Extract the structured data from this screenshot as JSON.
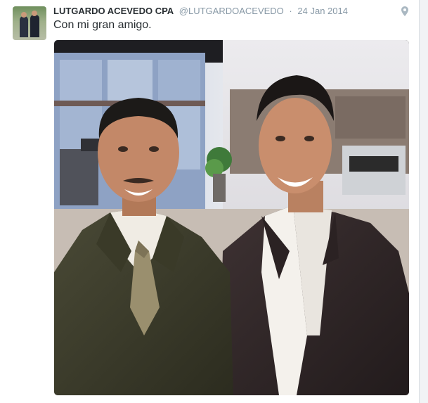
{
  "tweet": {
    "author_name": "LUTGARDO ACEVEDO CPA",
    "handle": "@LUTGARDOACEVEDO",
    "separator": "·",
    "date": "24 Jan 2014",
    "text": "Con mi gran amigo.",
    "location_icon": "location-pin-icon"
  },
  "colors": {
    "name": "#292f33",
    "meta": "#8899a6",
    "background": "#ffffff"
  }
}
